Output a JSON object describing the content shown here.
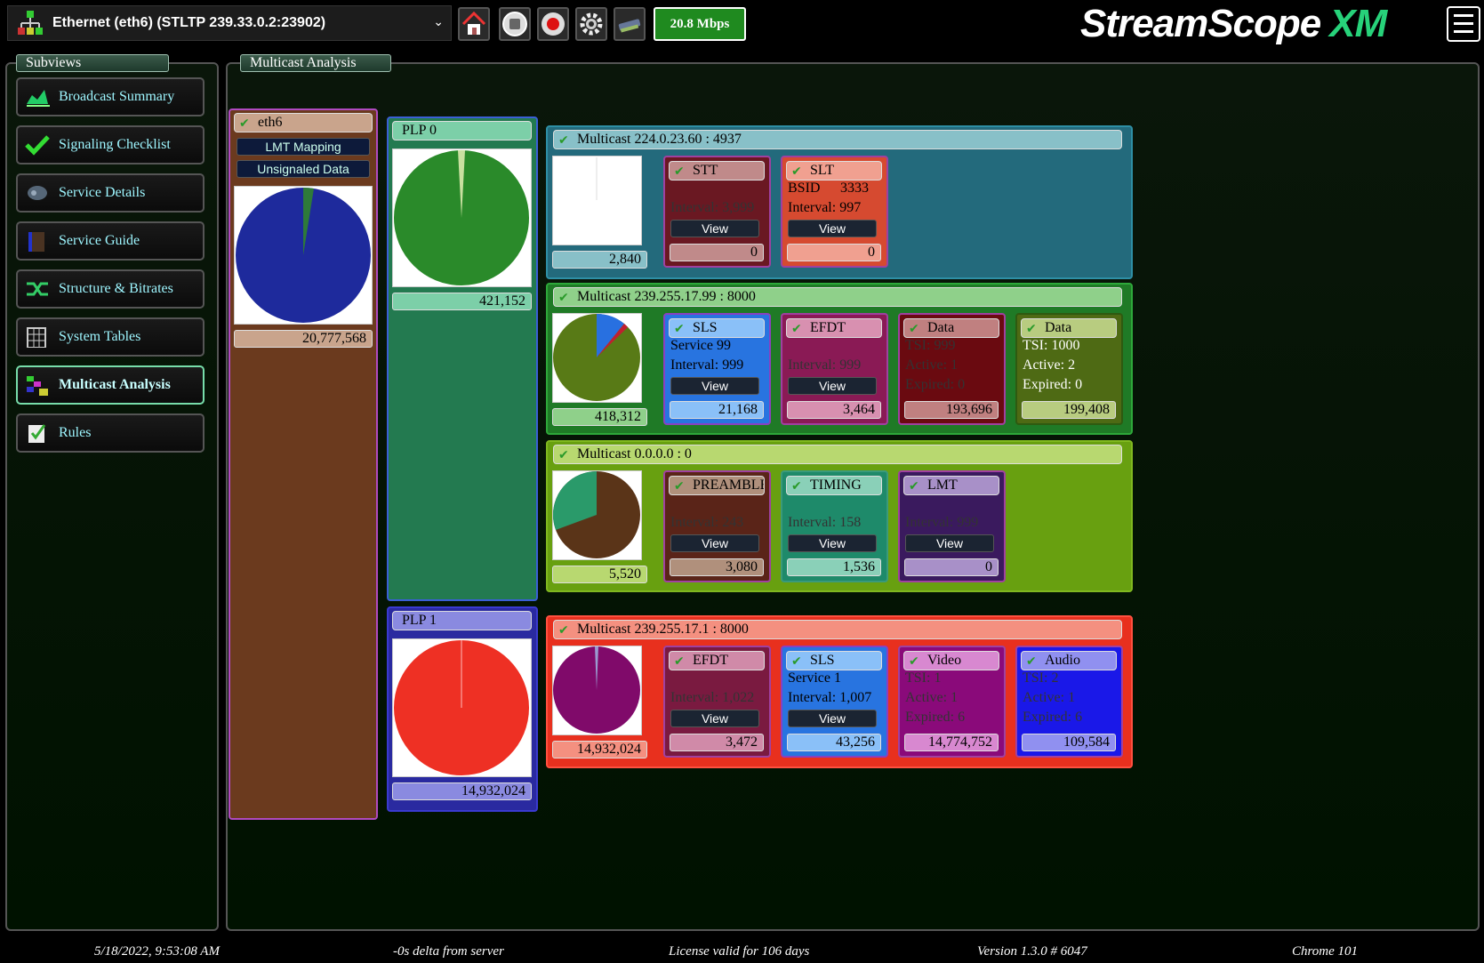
{
  "top": {
    "source": "Ethernet (eth6) (STLTP 239.33.0.2:23902)",
    "rate": "20.8 Mbps",
    "logo": "StreamScope",
    "logo_suffix": "XM"
  },
  "subviews": {
    "title": "Subviews",
    "items": [
      {
        "label": "Broadcast Summary",
        "icon": "broadcast-icon"
      },
      {
        "label": "Signaling Checklist",
        "icon": "checkmark-icon"
      },
      {
        "label": "Service Details",
        "icon": "service-icon"
      },
      {
        "label": "Service Guide",
        "icon": "guide-icon"
      },
      {
        "label": "Structure & Bitrates",
        "icon": "structure-icon"
      },
      {
        "label": "System Tables",
        "icon": "tables-icon"
      },
      {
        "label": "Multicast Analysis",
        "icon": "multicast-icon"
      },
      {
        "label": "Rules",
        "icon": "rules-icon"
      }
    ],
    "active": "Multicast Analysis"
  },
  "main": {
    "title": "Multicast Analysis",
    "iface": {
      "label": "eth6",
      "btn1": "LMT Mapping",
      "btn2": "Unsignaled Data",
      "value": "20,777,568"
    },
    "plp0": {
      "label": "PLP   0",
      "value": "421,152"
    },
    "plp1": {
      "label": "PLP   1",
      "value": "14,932,024"
    },
    "mc1": {
      "label": "Multicast 224.0.23.60 : 4937",
      "value": "2,840",
      "stt": {
        "label": "STT",
        "interval": "Interval: 3,999",
        "value": "0"
      },
      "slt": {
        "label": "SLT",
        "bsid_label": "BSID",
        "bsid": "3333",
        "interval": "Interval: 997",
        "value": "0"
      }
    },
    "mc2": {
      "label": "Multicast 239.255.17.99 : 8000",
      "value": "418,312",
      "sls": {
        "label": "SLS",
        "service": "Service  99",
        "interval": "Interval: 999",
        "value": "21,168"
      },
      "efdt": {
        "label": "EFDT",
        "interval": "Interval: 999",
        "value": "3,464"
      },
      "data1": {
        "label": "Data",
        "tsi": "TSI: 999",
        "active": "Active:   1",
        "expired": "Expired: 0",
        "value": "193,696"
      },
      "data2": {
        "label": "Data",
        "tsi": "TSI: 1000",
        "active": "Active:   2",
        "expired": "Expired: 0",
        "value": "199,408"
      }
    },
    "mc3": {
      "label": "Multicast 0.0.0.0 : 0",
      "value": "5,520",
      "preamble": {
        "label": "PREAMBLE",
        "interval": "Interval: 243",
        "value": "3,080"
      },
      "timing": {
        "label": "TIMING",
        "interval": "Interval: 158",
        "value": "1,536"
      },
      "lmt": {
        "label": "LMT",
        "interval": "Interval: 999",
        "value": "0"
      }
    },
    "mc4": {
      "label": "Multicast 239.255.17.1 : 8000",
      "value": "14,932,024",
      "efdt": {
        "label": "EFDT",
        "interval": "Interval: 1,022",
        "value": "3,472"
      },
      "sls": {
        "label": "SLS",
        "service": "Service   1",
        "interval": "Interval: 1,007",
        "value": "43,256"
      },
      "video": {
        "label": "Video",
        "tsi": "TSI: 1",
        "active": "Active:   1",
        "expired": "Expired: 6",
        "value": "14,774,752"
      },
      "audio": {
        "label": "Audio",
        "tsi": "TSI: 2",
        "active": "Active:   1",
        "expired": "Expired: 6",
        "value": "109,584"
      }
    },
    "view_label": "View"
  },
  "status": {
    "datetime": "5/18/2022, 9:53:08 AM",
    "delta": "-0s delta from server",
    "license": "License valid for 106 days",
    "version": "Version 1.3.0 # 6047",
    "browser": "Chrome 101"
  }
}
